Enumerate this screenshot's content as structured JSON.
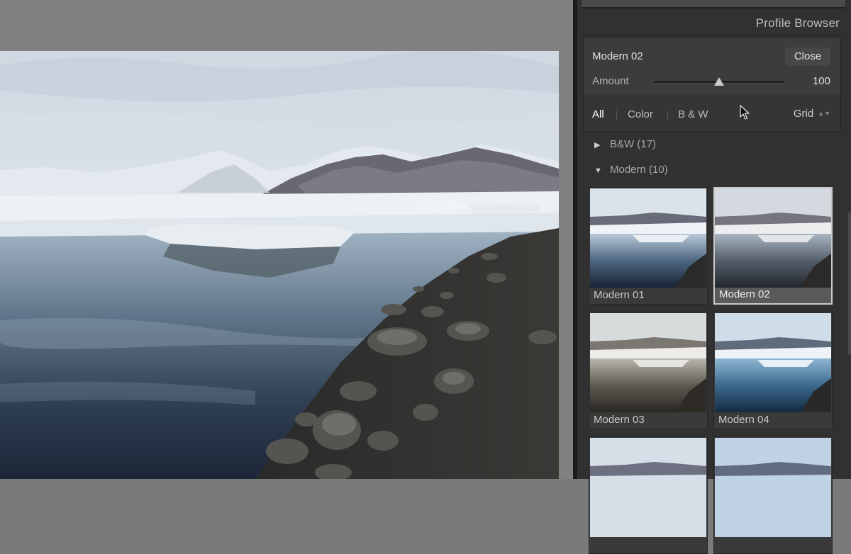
{
  "panel": {
    "title": "Profile Browser"
  },
  "header": {
    "profile_name": "Modern 02",
    "close_label": "Close",
    "amount_label": "Amount",
    "amount_value": "100",
    "amount_fraction": 0.5
  },
  "filters": {
    "all": "All",
    "color": "Color",
    "bw": "B & W",
    "active": "All",
    "view_mode": "Grid"
  },
  "groups": [
    {
      "label": "B&W (17)",
      "expanded": false
    },
    {
      "label": "Modern (10)",
      "expanded": true
    }
  ],
  "profiles": [
    {
      "label": "Modern 01",
      "selected": false
    },
    {
      "label": "Modern 02",
      "selected": true
    },
    {
      "label": "Modern 03",
      "selected": false
    },
    {
      "label": "Modern 04",
      "selected": false
    },
    {
      "label": "",
      "selected": false
    },
    {
      "label": "",
      "selected": false
    }
  ],
  "icons": {
    "collapsed": "triangle-right-icon",
    "expanded": "triangle-down-icon",
    "sort": "updown-arrows-icon",
    "cursor": "mouse-pointer-icon"
  },
  "colors": {
    "panel_bg": "#313131",
    "header_bg": "#3c3c3c",
    "canvas_bg": "#808080",
    "text_active": "#ffffff"
  }
}
